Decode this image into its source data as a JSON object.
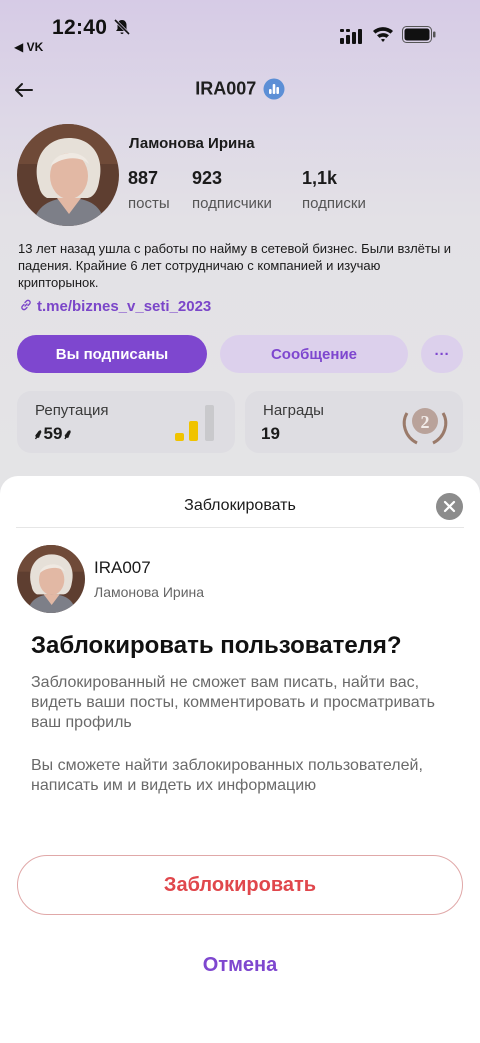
{
  "status_bar": {
    "time": "12:40",
    "back_app": "◀ VK"
  },
  "header": {
    "username": "IRA007"
  },
  "profile": {
    "full_name": "Ламонова Ирина",
    "stats": [
      {
        "value": "887",
        "label": "посты"
      },
      {
        "value": "923",
        "label": "подписчики"
      },
      {
        "value": "1,1k",
        "label": "подписки"
      }
    ],
    "bio": "13 лет назад ушла с работы по найму в сетевой бизнес. Были взлёты и падения. Крайние 6 лет сотрудничаю с компанией и изучаю крипторынок.",
    "link": "t.me/biznes_v_seti_2023"
  },
  "actions": {
    "subscribed_label": "Вы подписаны",
    "message_label": "Сообщение",
    "more_label": "···"
  },
  "reputation": {
    "title": "Репутация",
    "value": "59",
    "level_bars": 2
  },
  "awards": {
    "title": "Награды",
    "value": "19",
    "badge_number": "2"
  },
  "sheet": {
    "title": "Заблокировать",
    "user_nick": "IRA007",
    "user_name": "Ламонова Ирина",
    "headline": "Заблокировать пользователя?",
    "paragraph1": "Заблокированный не сможет вам писать, найти вас, видеть ваши посты, комментировать и просматривать ваш профиль",
    "paragraph2": "Вы сможете найти заблокированных пользователей, написать им и видеть их информацию",
    "block_button": "Заблокировать",
    "cancel_button": "Отмена"
  },
  "colors": {
    "accent": "#7e47cf",
    "danger": "#e0474c",
    "gold": "#f0c300"
  }
}
